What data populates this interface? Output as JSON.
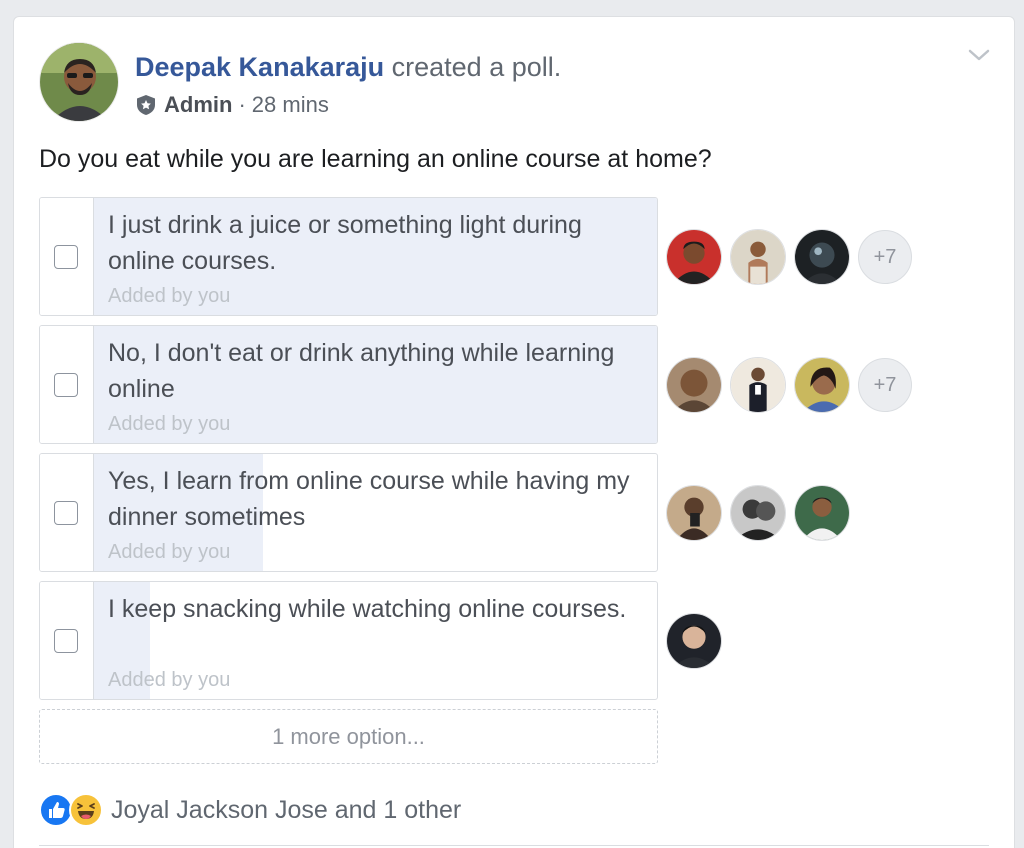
{
  "post": {
    "author": "Deepak Kanakaraju",
    "action": " created a poll.",
    "role": "Admin",
    "separator": "·",
    "time": "28 mins",
    "question": "Do you eat while you are learning an online course at home?"
  },
  "poll": {
    "options": [
      {
        "text": "I just drink a juice or something light during online courses.",
        "added_by": "Added by you",
        "vote_fraction": 1.0,
        "voters": [
          "voter-1",
          "voter-2",
          "voter-3"
        ],
        "more_voters": "+7"
      },
      {
        "text": "No, I don't eat or drink anything while learning online",
        "added_by": "Added by you",
        "vote_fraction": 1.0,
        "voters": [
          "voter-4",
          "voter-5",
          "voter-6"
        ],
        "more_voters": "+7"
      },
      {
        "text": "Yes, I learn from online course while having my dinner sometimes",
        "added_by": "Added by you",
        "vote_fraction": 0.3,
        "voters": [
          "voter-7",
          "voter-8",
          "voter-9"
        ],
        "more_voters": ""
      },
      {
        "text": "I keep snacking while watching online courses.",
        "added_by": "Added by you",
        "vote_fraction": 0.1,
        "voters": [
          "voter-10"
        ],
        "more_voters": ""
      }
    ],
    "more_options_label": "1 more option..."
  },
  "reactions": {
    "icons": [
      "like-icon",
      "haha-icon"
    ],
    "text": "Joyal Jackson Jose and 1 other"
  },
  "colors": {
    "link": "#365899",
    "vote_fill": "#ebeff8",
    "like_blue": "#1877f2",
    "haha_yellow": "#f7c23a"
  }
}
